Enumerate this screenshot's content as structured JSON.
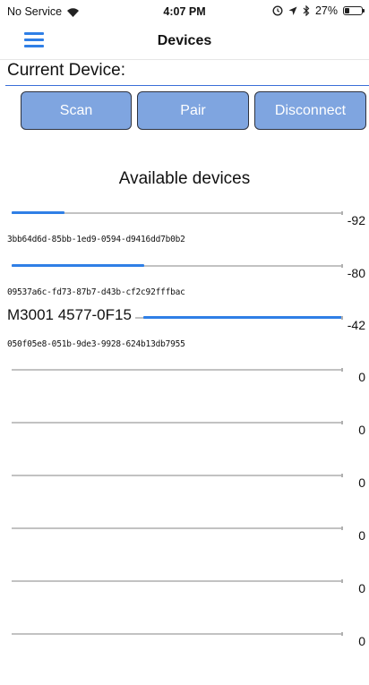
{
  "status_bar": {
    "carrier": "No Service",
    "time": "4:07 PM",
    "battery_percent": "27%",
    "battery_level": 0.27,
    "icons": [
      "wifi-icon",
      "alarm-icon",
      "location-arrow-icon",
      "bluetooth-icon",
      "battery-icon"
    ]
  },
  "nav": {
    "title": "Devices",
    "menu_icon": "hamburger-menu-icon"
  },
  "current_device": {
    "label": "Current Device:",
    "value": ""
  },
  "buttons": {
    "scan": "Scan",
    "pair": "Pair",
    "disconnect": "Disconnect"
  },
  "available_heading": "Available devices",
  "colors": {
    "accent": "#2f7fe6",
    "button_bg": "#7fa5e0",
    "underline": "#3a6fd8"
  },
  "devices": [
    {
      "name": "",
      "id": "3bb64d6d-85bb-1ed9-0594-d9416dd7b0b2",
      "rssi": "-92",
      "signal_fraction": 0.16
    },
    {
      "name": "",
      "id": "09537a6c-fd73-87b7-d43b-cf2c92fffbac",
      "rssi": "-80",
      "signal_fraction": 0.4
    },
    {
      "name": "M3001 4577-0F15",
      "id": "050f05e8-051b-9de3-9928-624b13db7955",
      "rssi": "-42",
      "signal_fraction": 1.0
    },
    {
      "name": "",
      "id": "",
      "rssi": "0",
      "signal_fraction": 0
    },
    {
      "name": "",
      "id": "",
      "rssi": "0",
      "signal_fraction": 0
    },
    {
      "name": "",
      "id": "",
      "rssi": "0",
      "signal_fraction": 0
    },
    {
      "name": "",
      "id": "",
      "rssi": "0",
      "signal_fraction": 0
    },
    {
      "name": "",
      "id": "",
      "rssi": "0",
      "signal_fraction": 0
    },
    {
      "name": "",
      "id": "",
      "rssi": "0",
      "signal_fraction": 0
    }
  ]
}
